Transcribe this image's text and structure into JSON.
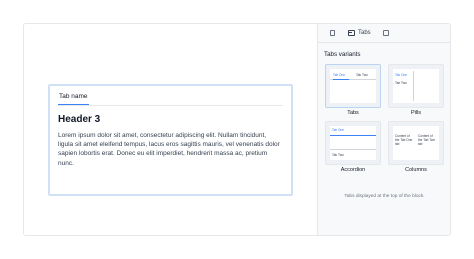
{
  "canvas": {
    "block": {
      "tab_label": "Tab name",
      "heading": "Header 3",
      "body": "Lorem ipsum dolor sit amet, consectetur adipiscing elit. Nullam tincidunt, ligula sit amet eleifend tempus, lacus eros sagittis mauris, vel venenatis dolor sapien lobortis erat. Donec eu elit imperdiet, hendrerit massa ac, pretium nunc."
    }
  },
  "panel": {
    "top_tabs": [
      {
        "icon": "page-icon",
        "label": ""
      },
      {
        "icon": "tabs-icon",
        "label": "Tabs"
      },
      {
        "icon": "square-icon",
        "label": ""
      }
    ],
    "section_title": "Tabs variants",
    "variants": [
      {
        "label": "Tabs",
        "selected": true,
        "preview": [
          "Tab One",
          "Tab Two"
        ]
      },
      {
        "label": "Pills",
        "selected": false,
        "preview": [
          "Tab One",
          "Tab Two"
        ]
      },
      {
        "label": "Accordion",
        "selected": false,
        "preview": [
          "Tab One",
          "Tab Two"
        ]
      },
      {
        "label": "Columns",
        "selected": false,
        "preview": [
          "Content of the Tab One tab",
          "Content of the Tab Two tab"
        ]
      }
    ],
    "caption": "Tabs displayed at the top of the block."
  },
  "colors": {
    "accent": "#3b82f6",
    "selection_border": "#cfe0f7",
    "panel_bg": "#f8f9fa"
  }
}
